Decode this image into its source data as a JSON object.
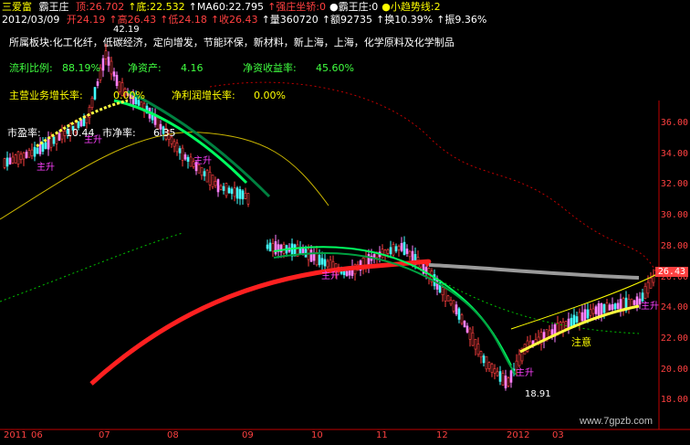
{
  "header": {
    "indicator": "三爱富",
    "formula": "霸王庄",
    "tokens": [
      {
        "text": "顶:26.702",
        "color": "#ff4040"
      },
      {
        "text": "↑底:22.532",
        "color": "#ffff00"
      },
      {
        "text": "↑MA60:22.795",
        "color": "#ffffff"
      },
      {
        "text": "↑强庄坐轿:0",
        "color": "#ff4040"
      },
      {
        "text": "●霸王庄:0",
        "color": "#ffffff"
      },
      {
        "text": "●小趋势线:2",
        "color": "#ffff00"
      }
    ]
  },
  "quote": {
    "date": "2012/03/09",
    "tokens": [
      {
        "text": "开24.19",
        "color": "#ff4040"
      },
      {
        "text": "↑高26.43",
        "color": "#ff4040"
      },
      {
        "text": "↑低24.18",
        "color": "#ff4040"
      },
      {
        "text": "↑收26.43",
        "color": "#ff4040"
      },
      {
        "text": "↑量360720",
        "color": "#ffffff"
      },
      {
        "text": "↑额92735",
        "color": "#ffffff"
      },
      {
        "text": "↑换10.39%",
        "color": "#ffffff"
      },
      {
        "text": "↑振9.36%",
        "color": "#ffffff"
      }
    ]
  },
  "sector": "所属板块:化工化纤，低碳经济，定向增发，节能环保，新材料，新上海，上海，化学原料及化学制品",
  "fundamentals": {
    "circulation_label": "流利比例:",
    "circulation_value": "88.19%",
    "net_assets_label": "净资产:",
    "net_assets_value": "4.16",
    "roe_label": "净资收益率:",
    "roe_value": "45.60%",
    "revenue_growth_label": "主营业务增长率:",
    "revenue_growth_value": "0.00%",
    "profit_growth_label": "净利润增长率:",
    "profit_growth_value": "0.00%",
    "pe_label": "市盈率:",
    "pe_value": "10.44",
    "pb_label": "市净率:",
    "pb_value": "6.35"
  },
  "annotations": {
    "high": "42.19",
    "low": "18.91",
    "signal_1": "主升",
    "signal_2": "主升",
    "signal_3": "主升",
    "signal_4": "主升",
    "signal_5": "主升",
    "signal_6": "主升",
    "notice": "注意"
  },
  "current_price": "26.43",
  "y_axis": [
    "36.00",
    "34.00",
    "32.00",
    "30.00",
    "28.00",
    "26.00",
    "24.00",
    "22.00",
    "20.00",
    "18.00"
  ],
  "x_axis": [
    "2011",
    "06",
    "07",
    "08",
    "09",
    "10",
    "11",
    "12",
    "2012",
    "03"
  ],
  "watermark": "www.7gpzb.com",
  "colors": {
    "up": "#ff4040",
    "down": "#ff80ff",
    "bg": "#000000",
    "axis": "#c00000"
  }
}
